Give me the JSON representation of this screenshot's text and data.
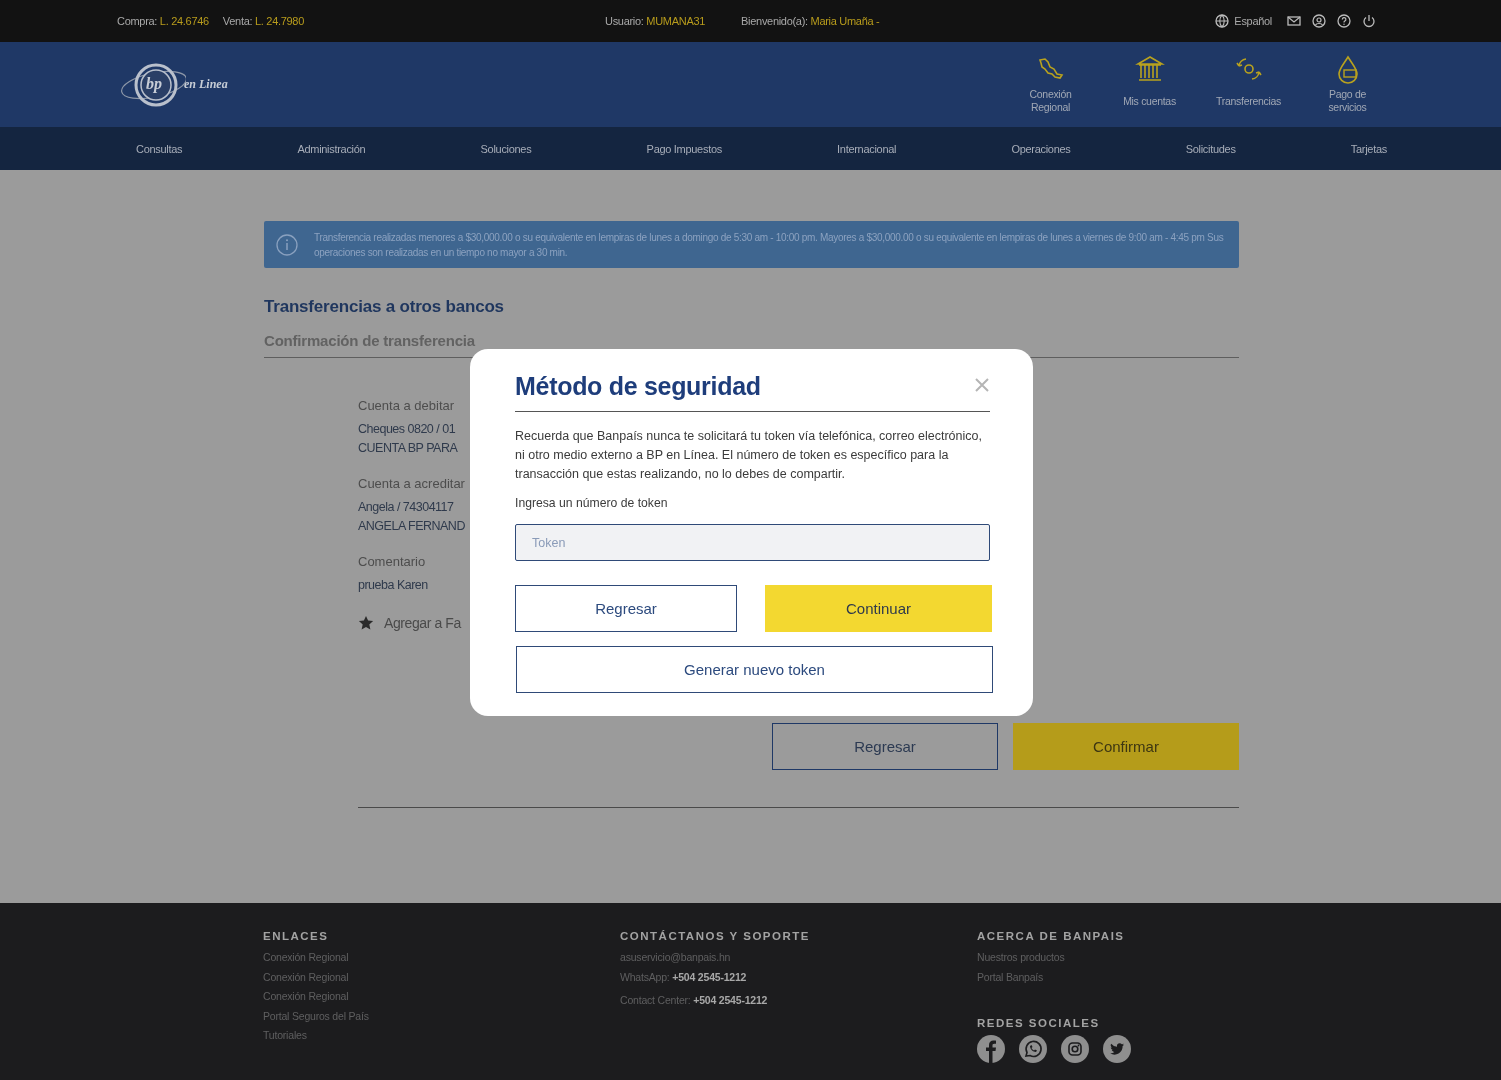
{
  "top_bar": {
    "rates": [
      {
        "label": "Compra:",
        "value": "L. 24.6746"
      },
      {
        "label": "Venta:",
        "value": "L. 24.7980"
      }
    ],
    "user": {
      "label": "Usuario:",
      "value": "MUMANA31"
    },
    "welcome": {
      "label": "Bienvenido(a):",
      "value": "Maria Umaña -"
    },
    "language": "Español"
  },
  "header": {
    "logo": {
      "mark": "bp",
      "text": "en Linea"
    },
    "quick_links": [
      {
        "label": "Conexión Regional",
        "kind": "map"
      },
      {
        "label": "Mis cuentas",
        "kind": "bank"
      },
      {
        "label": "Transferencias",
        "kind": "transfer"
      },
      {
        "label": "Pago de servicios",
        "kind": "drop"
      }
    ]
  },
  "nav": [
    "Consultas",
    "Administración",
    "Soluciones",
    "Pago Impuestos",
    "Internacional",
    "Operaciones",
    "Solicitudes",
    "Tarjetas"
  ],
  "info_banner": "Transferencia realizadas menores a $30,000.00 o su equivalente en lempiras de lunes a domingo de 5:30 am - 10:00 pm. Mayores a $30,000.00 o su equivalente en lempiras de lunes a viernes de 9:00 am - 4:45 pm Sus operaciones son realizadas en un tiempo no mayor a 30 min.",
  "page_title": "Transferencias a otros bancos",
  "page_subtitle": "Confirmación de transferencia",
  "details": [
    {
      "label": "Cuenta a debitar",
      "lines": [
        "Cheques 0820 / 01",
        "CUENTA BP PARA"
      ]
    },
    {
      "label": "Cuenta a acreditar",
      "lines": [
        "Angela / 74304117",
        "ANGELA FERNAND"
      ]
    },
    {
      "label": "Comentario",
      "lines": [
        "prueba Karen"
      ]
    }
  ],
  "favorite": "Agregar a Fa",
  "page_buttons": [
    {
      "label": "Regresar",
      "kind": "outline"
    },
    {
      "label": "Confirmar",
      "kind": "primary"
    }
  ],
  "modal": {
    "title": "Método de seguridad",
    "message": "Recuerda que Banpaís nunca te solicitará tu token vía telefónica, correo electrónico, ni otro medio externo a BP en Línea. El número de token es específico para la transacción que estas realizando, no lo debes de compartir.",
    "token_label": "Ingresa un número de token",
    "token_placeholder": "Token",
    "buttons": [
      {
        "label": "Regresar",
        "kind": "outline"
      },
      {
        "label": "Continuar",
        "kind": "primary"
      }
    ],
    "new_token_button": "Generar nuevo token"
  },
  "footer": {
    "columns": [
      {
        "title": "ENLACES",
        "items": [
          "Conexión Regional",
          "Conexión Regional",
          "Conexión Regional",
          "Portal Seguros del País",
          "Tutoriales"
        ]
      },
      {
        "title": "CONTÁCTANOS Y SOPORTE",
        "contact": [
          {
            "label": "asuservicio@banpais.hn"
          },
          {
            "label": "WhatsApp:",
            "value": "+504 2545-1212"
          },
          {
            "label": "Contact Center:",
            "value": "+504 2545-1212"
          }
        ]
      },
      {
        "title": "ACERCA DE BANPAIS",
        "items": [
          "Nuestros productos",
          "Portal Banpaís"
        ],
        "social_title": "REDES SOCIALES"
      }
    ]
  }
}
